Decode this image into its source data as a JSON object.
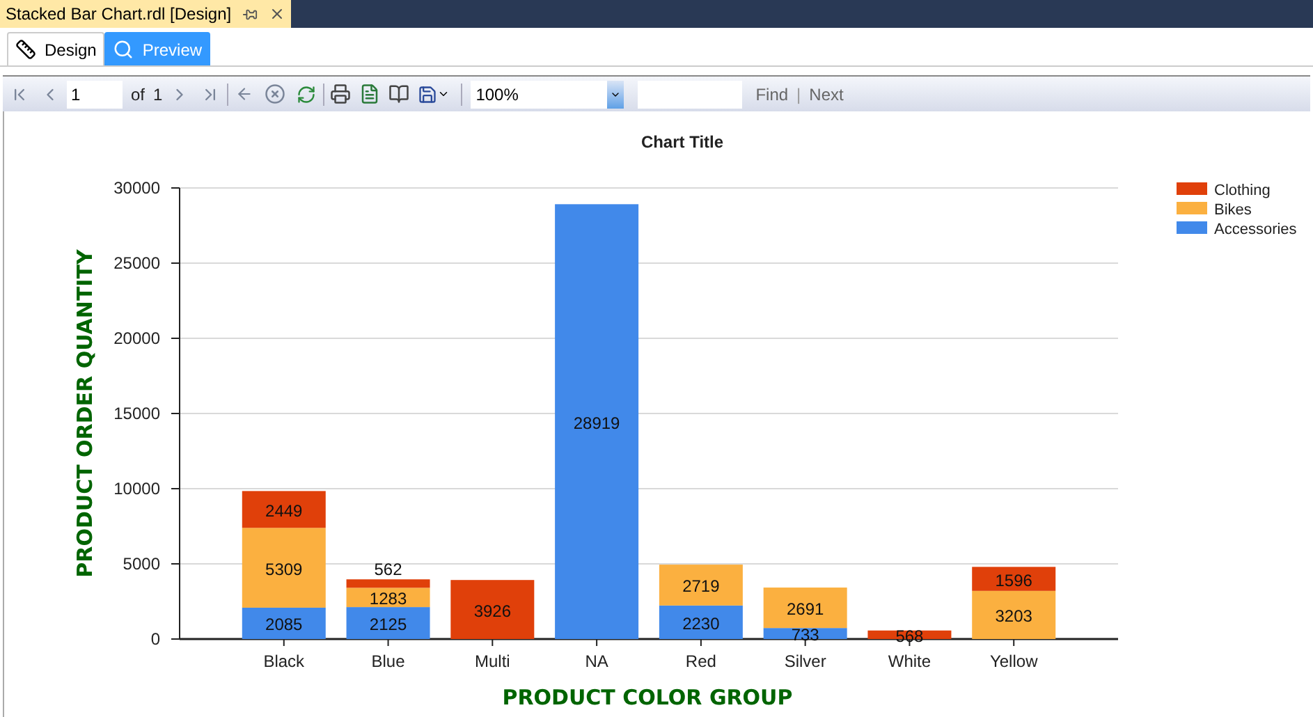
{
  "document_tab": {
    "title": "Stacked Bar Chart.rdl [Design]"
  },
  "view_tabs": [
    {
      "label": "Design",
      "kind": "design",
      "selected": false
    },
    {
      "label": "Preview",
      "kind": "preview",
      "selected": true
    }
  ],
  "toolbar": {
    "page": "1",
    "of_label": "of",
    "total_pages": "1",
    "zoom": "100%",
    "find_label": "Find",
    "separator": "|",
    "next_label": "Next"
  },
  "chart": {
    "chart_data": {
      "type": "bar",
      "title": "Chart Title",
      "xlabel": "PRODUCT COLOR GROUP",
      "ylabel": "PRODUCT ORDER QUANTITY",
      "stacked": true,
      "orientation": "vertical",
      "data_labels": true,
      "categories": [
        "Black",
        "Blue",
        "Multi",
        "NA",
        "Red",
        "Silver",
        "White",
        "Yellow"
      ],
      "ylim": [
        0,
        30000
      ],
      "grid": {
        "horizontal": true
      },
      "legend": true,
      "yticks": [
        0,
        5000,
        10000,
        15000,
        20000,
        25000,
        30000
      ],
      "series": [
        {
          "name": "Accessories",
          "color": "#4189ea",
          "values": [
            2085,
            2125,
            null,
            28919,
            2230,
            733,
            null,
            null
          ]
        },
        {
          "name": "Bikes",
          "color": "#fbb040",
          "values": [
            5309,
            1283,
            null,
            null,
            2719,
            2691,
            null,
            3203
          ]
        },
        {
          "name": "Clothing",
          "color": "#e0400a",
          "values": [
            2449,
            562,
            3926,
            null,
            null,
            null,
            568,
            1596
          ]
        }
      ]
    }
  }
}
